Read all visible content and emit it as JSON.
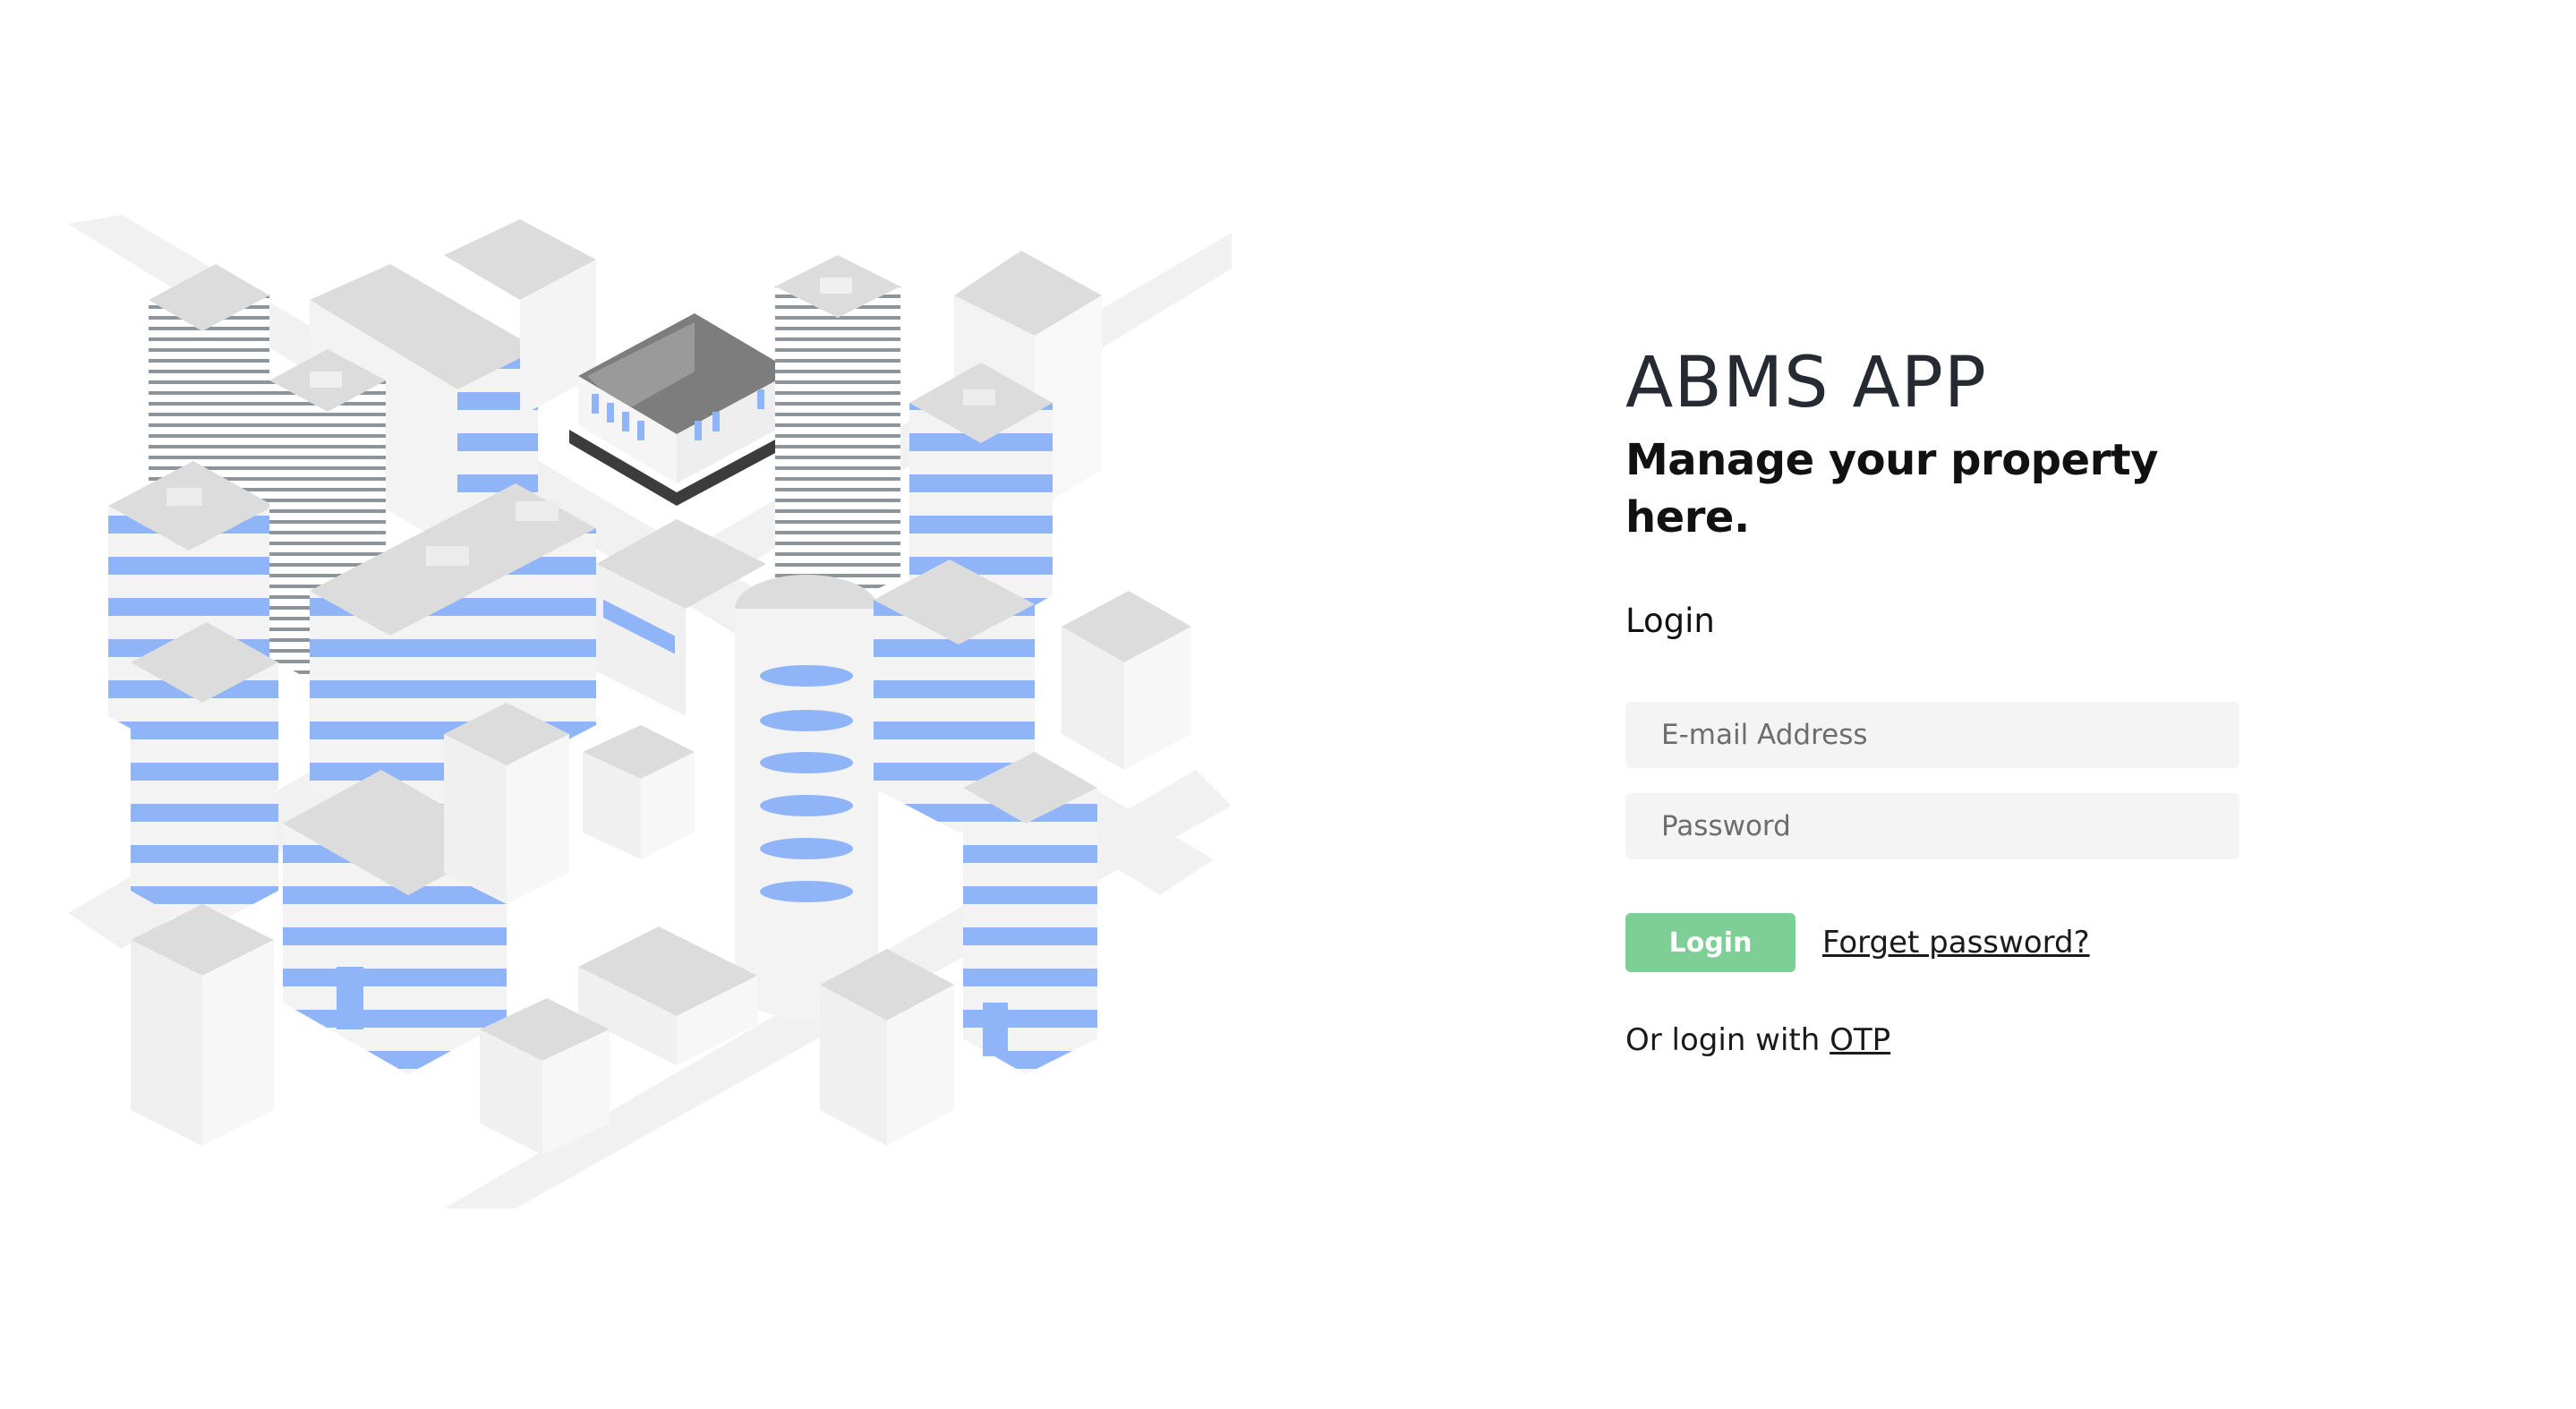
{
  "app": {
    "title": "ABMS APP",
    "tagline": "Manage your property here."
  },
  "login_form": {
    "section_label": "Login",
    "email": {
      "value": "",
      "placeholder": "E-mail Address"
    },
    "password": {
      "value": "",
      "placeholder": "Password"
    },
    "submit_label": "Login",
    "forgot_label": "Forget password?",
    "otp_prefix": "Or login with ",
    "otp_link_label": "OTP"
  },
  "illustration": {
    "icon": "isometric-city-illustration"
  },
  "colors": {
    "accent_green": "#7ecf95",
    "building_stripe_blue": "#8fb4f7",
    "title_text": "#252a33",
    "input_background": "#f4f4f4"
  }
}
